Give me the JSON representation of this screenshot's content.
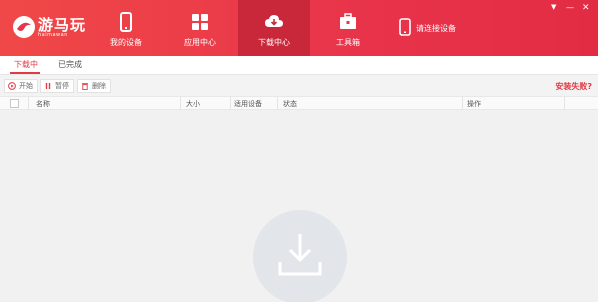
{
  "app": {
    "logo_text": "游马玩",
    "logo_sub": "haimawan"
  },
  "nav": {
    "items": [
      {
        "label": "我的设备",
        "icon": "phone-icon"
      },
      {
        "label": "应用中心",
        "icon": "apps-grid-icon"
      },
      {
        "label": "下载中心",
        "icon": "cloud-download-icon"
      },
      {
        "label": "工具箱",
        "icon": "toolbox-icon"
      }
    ],
    "connect_label": "请连接设备",
    "active_index": 2
  },
  "window_controls": {
    "menu": "▼",
    "minimize": "—",
    "close": "✕"
  },
  "tabs": {
    "downloading": "下载中",
    "completed": "已完成"
  },
  "toolbar": {
    "start_label": "开始",
    "pause_label": "暂停",
    "delete_label": "删除",
    "install_fail_label": "安装失败?"
  },
  "table": {
    "headers": {
      "name": "名称",
      "size": "大小",
      "device": "适用设备",
      "status": "状态",
      "action": "操作"
    },
    "rows": []
  },
  "colors": {
    "brand_red": "#e8344a",
    "active_nav": "#c8283a",
    "accent_text": "#e23a44"
  }
}
